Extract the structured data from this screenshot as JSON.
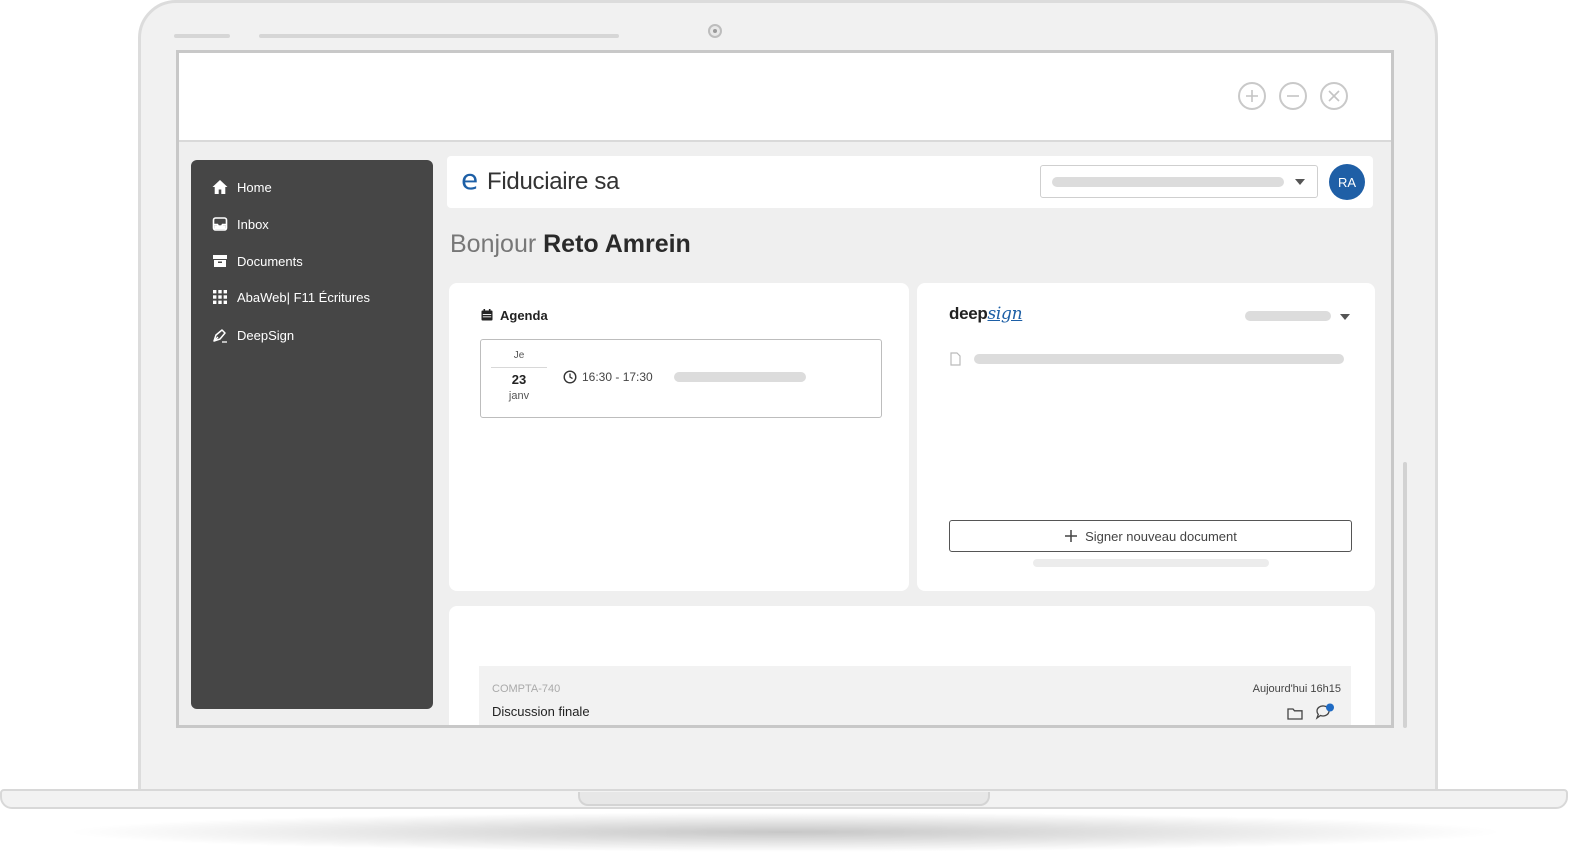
{
  "colors": {
    "accent": "#1d5fa6",
    "sidebar_bg": "#464646",
    "app_bg": "#efefef",
    "notification_dot": "#1f6bc4"
  },
  "window_controls": {
    "maximize_icon": "plus-circle-icon",
    "minimize_icon": "minus-circle-icon",
    "close_icon": "close-circle-icon"
  },
  "sidebar": {
    "items": [
      {
        "label": "Home",
        "icon": "home-icon"
      },
      {
        "label": "Inbox",
        "icon": "inbox-icon"
      },
      {
        "label": "Documents",
        "icon": "archive-box-icon"
      },
      {
        "label": "AbaWeb| F11 Écritures",
        "icon": "grid-apps-icon"
      },
      {
        "label": "DeepSign",
        "icon": "pen-sign-icon"
      }
    ]
  },
  "header": {
    "logo_mark": "e",
    "logo_text": "Fiduciaire sa",
    "user_initials": "RA"
  },
  "greeting": {
    "prefix": "Bonjour",
    "name": "Reto Amrein"
  },
  "agenda": {
    "title": "Agenda",
    "event": {
      "weekday": "Je",
      "day": "23",
      "month": "janv",
      "time": "16:30 - 17:30"
    }
  },
  "deepsign": {
    "logo_bold": "deep",
    "logo_script": "sign",
    "new_button_label": "Signer nouveau document"
  },
  "activity": {
    "items": [
      {
        "reference": "COMPTA-740",
        "title": "Discussion finale",
        "timestamp": "Aujourd'hui 16h15"
      }
    ]
  }
}
